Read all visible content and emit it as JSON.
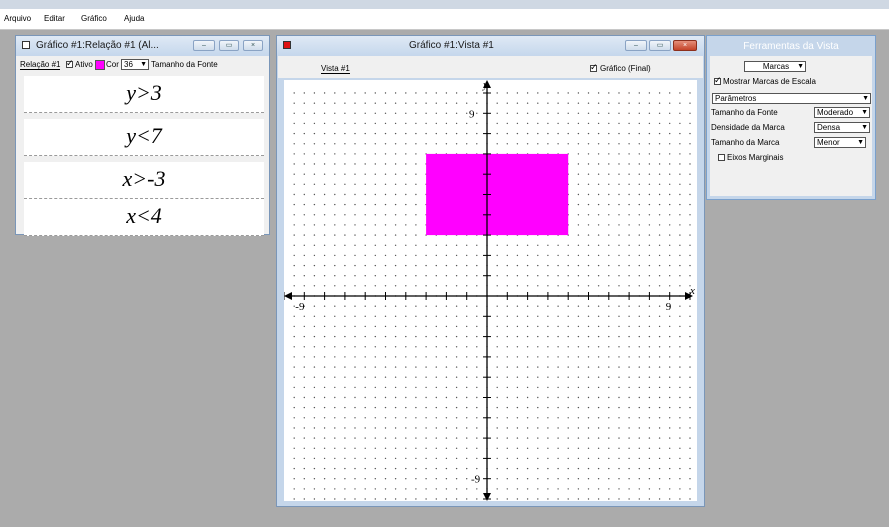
{
  "menu": [
    "Arquivo",
    "Editar",
    "Gráfico",
    "Ajuda"
  ],
  "relation_window": {
    "title": "Gráfico #1:Relação #1 (Al...",
    "tab": "Relação #1",
    "active_label": "Ativo",
    "color_label": "Cor",
    "color": "#ff00ff",
    "font_size_value": "36",
    "font_size_label": "Tamanho da Fonte",
    "equations": [
      "y>3",
      "y<7",
      "x>-3",
      "x<4"
    ]
  },
  "graph_window": {
    "title": "Gráfico #1:Vista #1",
    "tab": "Vista #1",
    "final_label": "Gráfico (Final)",
    "x_axis_label": "x",
    "y_axis_label": "y",
    "x_tick_neg": "-9",
    "x_tick_pos": "9",
    "y_tick_pos": "9",
    "y_tick_neg": "-9",
    "region": {
      "x_min": -3,
      "x_max": 4,
      "y_min": 3,
      "y_max": 7
    },
    "axis_range": [
      -10,
      10
    ],
    "region_color": "#ff00ff"
  },
  "tools": {
    "title": "Ferramentas da Vista",
    "select_marks": "Marcas",
    "show_marks_label": "Mostrar Marcas de Escala",
    "params_select": "Parâmetros",
    "font_size_label": "Tamanho da Fonte",
    "font_size_value": "Moderado",
    "density_label": "Densidade da Marca",
    "density_value": "Densa",
    "mark_size_label": "Tamanho da Marca",
    "mark_size_value": "Menor",
    "marginal_axes_label": "Eixos Marginais"
  }
}
